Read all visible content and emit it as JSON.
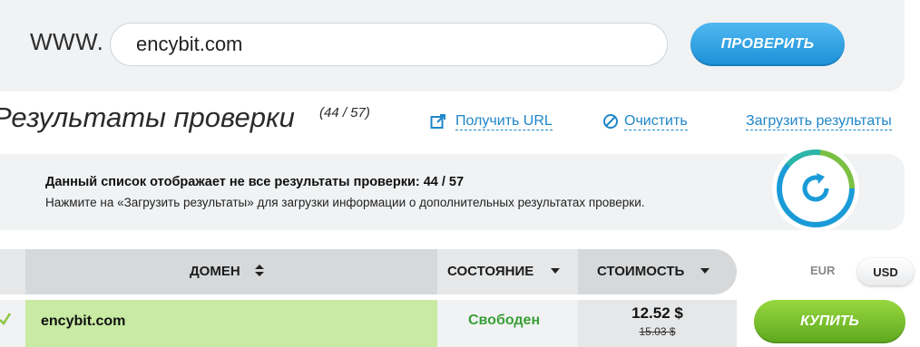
{
  "search": {
    "prefix": "WWW.",
    "value": "encybit.com",
    "check_label": "ПРОВЕРИТЬ"
  },
  "results": {
    "title": "Результаты проверки",
    "count": "(44 / 57)",
    "links": {
      "get_url": "Получить URL",
      "clear": "Очистить",
      "load": "Загрузить результаты"
    }
  },
  "info": {
    "bold": "Данный список отображает не все результаты проверки: 44 / 57",
    "text": "Нажмите на «Загрузить результаты» для загрузки информации о дополнительных результатах проверки."
  },
  "table": {
    "headers": {
      "domain": "ДОМЕН",
      "status": "СОСТОЯНИЕ",
      "cost": "СТОИМОСТЬ"
    },
    "currencies": [
      "EUR",
      "USD"
    ],
    "selected_currency": "USD",
    "rows": [
      {
        "domain": "encybit.com",
        "status": "Свободен",
        "price": "12.52 $",
        "old_price": "15.03 $",
        "buy_label": "КУПИТЬ"
      }
    ]
  },
  "colors": {
    "primary_button": "#2a9be0",
    "buy_button": "#7cc22c",
    "link": "#1f86c8",
    "available": "#3aa03a",
    "available_row": "#c8eaa2",
    "panel_bg": "#f0f2f4"
  },
  "icons": {
    "get_url": "external-link-icon",
    "clear": "cancel-icon",
    "info": "refresh-progress-icon",
    "row_check": "check-icon",
    "sort_domain": "sort-icon",
    "sort_status": "caret-down-icon",
    "sort_cost": "caret-down-icon"
  }
}
